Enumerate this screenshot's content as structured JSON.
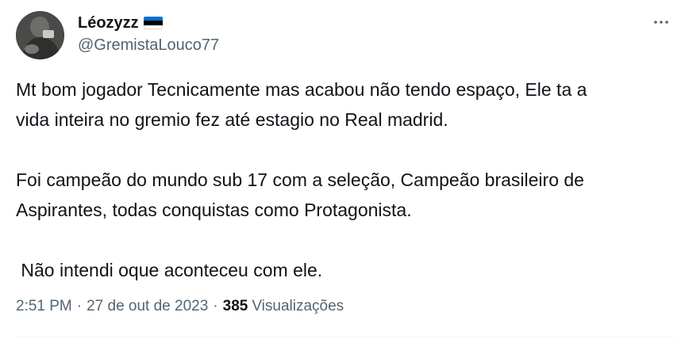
{
  "author": {
    "display_name": "Léozyzz",
    "handle": "@GremistaLouco77",
    "avatar_icon": "profile-photo",
    "flag_icon": "estonia-flag",
    "flag_colors": [
      "#0072ce",
      "#000000",
      "#ffffff"
    ]
  },
  "menu": {
    "icon": "more-options-icon"
  },
  "body": {
    "paragraph_1": "Mt bom jogador Tecnicamente mas acabou não tendo espaço, Ele ta a\nvida inteira no gremio fez até estagio no Real madrid.",
    "paragraph_2": "Foi campeão do mundo sub 17 com a seleção, Campeão brasileiro de\nAspirantes, todas conquistas como Protagonista.",
    "paragraph_3": " Não intendi oque aconteceu com ele."
  },
  "meta": {
    "time": "2:51 PM",
    "separator": "·",
    "date": "27 de out de 2023",
    "views_count": "385",
    "views_label": "Visualizações"
  },
  "colors": {
    "text_primary": "#0f1419",
    "text_secondary": "#536471",
    "divider": "#eff3f4"
  }
}
